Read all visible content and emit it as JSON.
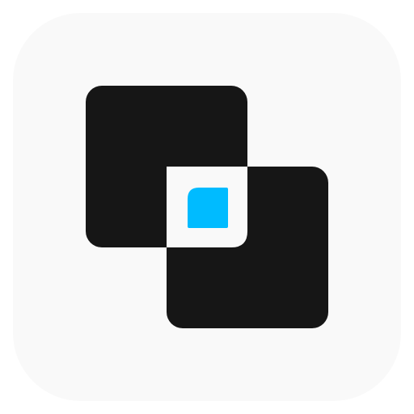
{
  "icon": {
    "name": "overlapping-squares-app-icon",
    "colors": {
      "tile_background": "#f9f9f9",
      "squares": "#161616",
      "intersection": "#f9f9f9",
      "accent": "#00bbff"
    }
  }
}
